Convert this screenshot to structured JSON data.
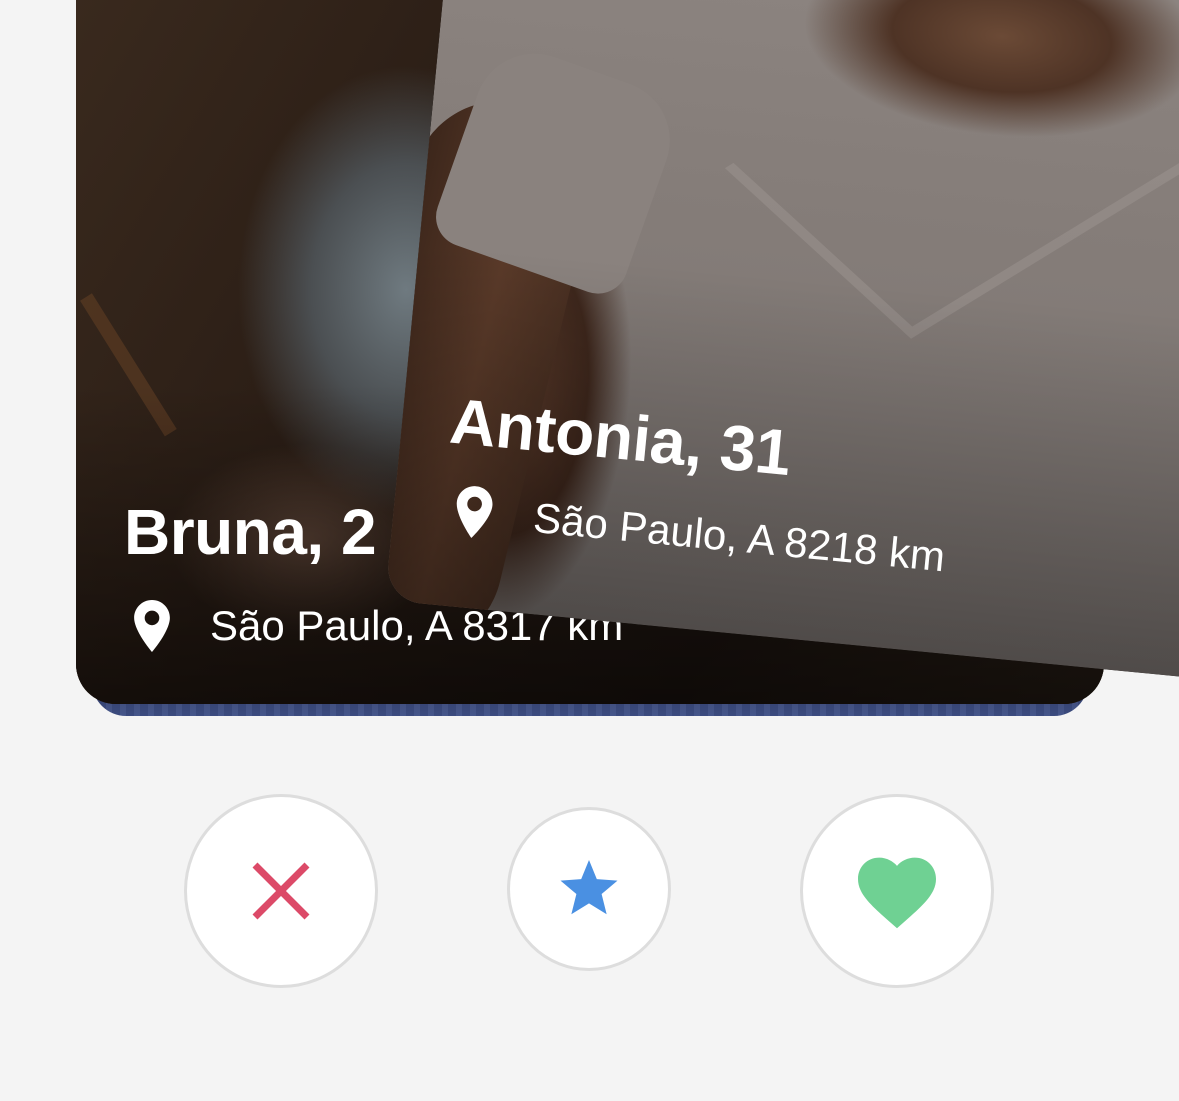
{
  "cards": [
    {
      "name_age": "Bruna, 2",
      "location": "São Paulo, A 8317 km",
      "location_icon": "map-pin-icon"
    },
    {
      "name_age": "Antonia, 31",
      "location": "São Paulo, A 8218 km",
      "location_icon": "map-pin-icon"
    }
  ],
  "actions": {
    "dislike": {
      "icon": "close-icon",
      "color": "#dc4a68"
    },
    "super_like": {
      "icon": "star-icon",
      "color": "#4a90e2"
    },
    "like": {
      "icon": "heart-icon",
      "color": "#6fd193"
    }
  },
  "colors": {
    "background": "#f4f4f4",
    "button_border": "#dddddd"
  }
}
